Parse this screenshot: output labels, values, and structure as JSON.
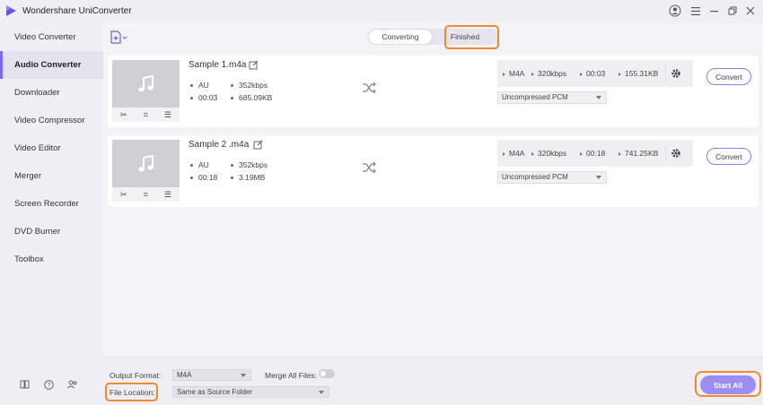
{
  "app": {
    "title": "Wondershare UniConverter"
  },
  "sidebar": {
    "items": [
      {
        "label": "Video Converter"
      },
      {
        "label": "Audio Converter",
        "active": true
      },
      {
        "label": "Downloader"
      },
      {
        "label": "Video Compressor"
      },
      {
        "label": "Video Editor"
      },
      {
        "label": "Merger"
      },
      {
        "label": "Screen Recorder"
      },
      {
        "label": "DVD Burner"
      },
      {
        "label": "Toolbox"
      }
    ]
  },
  "tabs": {
    "converting": "Converting",
    "finished": "Finished"
  },
  "files": [
    {
      "name": "Sample 1.m4a",
      "codec": "AU",
      "bitrate": "352kbps",
      "duration": "00:03",
      "size": "685.09KB",
      "out_format": "M4A",
      "out_bitrate": "320kbps",
      "out_duration": "00:03",
      "out_size": "155.31KB",
      "quality": "Uncompressed PCM",
      "convert_label": "Convert"
    },
    {
      "name": "Sample 2 .m4a",
      "codec": "AU",
      "bitrate": "352kbps",
      "duration": "00:18",
      "size": "3.19MB",
      "out_format": "M4A",
      "out_bitrate": "320kbps",
      "out_duration": "00:18",
      "out_size": "741.25KB",
      "quality": "Uncompressed PCM",
      "convert_label": "Convert"
    }
  ],
  "bottom": {
    "output_format_label": "Output Format:",
    "output_format_value": "M4A",
    "merge_label": "Merge All Files:",
    "merge_enabled": false,
    "file_location_label": "File Location:",
    "file_location_value": "Same as Source Folder",
    "start_all_label": "Start All"
  },
  "colors": {
    "accent": "#7b6cf6",
    "highlight": "#f08a2c",
    "start_button": "#9b8ef3"
  }
}
